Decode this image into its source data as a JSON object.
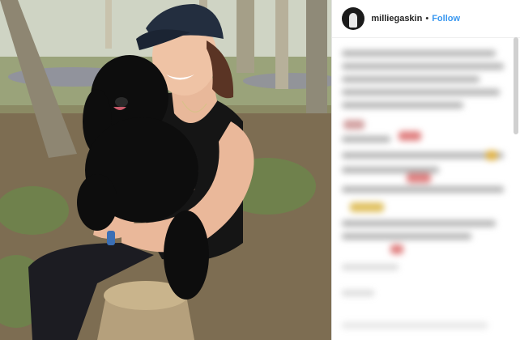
{
  "post": {
    "username": "milliegaskin",
    "separator": "•",
    "follow_label": "Follow"
  },
  "colors": {
    "link": "#3897f0",
    "text": "#262626"
  },
  "icons": {
    "avatar": "profile-avatar"
  }
}
